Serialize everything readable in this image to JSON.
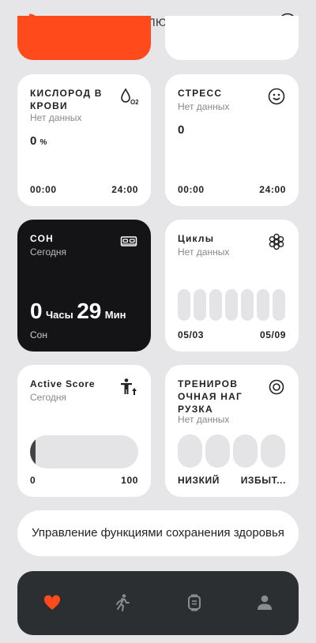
{
  "header": {
    "title": "ПОДКЛЮЧЕНО"
  },
  "cards": {
    "oxygen": {
      "title": "КИСЛОРОД В КРОВИ",
      "subtitle": "Нет данных",
      "value": "0",
      "unit": "%",
      "time_start": "00:00",
      "time_end": "24:00"
    },
    "stress": {
      "title": "СТРЕСС",
      "subtitle": "Нет данных",
      "value": "0",
      "time_start": "00:00",
      "time_end": "24:00"
    },
    "sleep": {
      "title": "СОН",
      "subtitle": "Сегодня",
      "hours_value": "0",
      "hours_unit": "Часы",
      "minutes_value": "29",
      "minutes_unit": "Мин",
      "footer": "Сон"
    },
    "cycles": {
      "title": "Циклы",
      "subtitle": "Нет данных",
      "date_start": "05/03",
      "date_end": "05/09"
    },
    "active_score": {
      "title": "Active Score",
      "subtitle": "Сегодня",
      "min": "0",
      "max": "100",
      "progress_fraction": 0.05
    },
    "training_load": {
      "title": "ТРЕНИРОВОЧНАЯ НАГРУЗКА",
      "subtitle": "Нет данных",
      "label_low": "НИЗКИЙ",
      "label_high": "ИЗБЫТ..."
    }
  },
  "manage_button": {
    "label": "Управление функциями сохранения здоровья"
  },
  "colors": {
    "accent": "#ff4a1c",
    "dark_card": "#141416",
    "navbar": "#2c2f32",
    "background": "#e6e6e8"
  },
  "nav": {
    "items": [
      "heart-icon",
      "runner-icon",
      "watch-icon",
      "profile-icon"
    ],
    "active": "heart-icon"
  }
}
